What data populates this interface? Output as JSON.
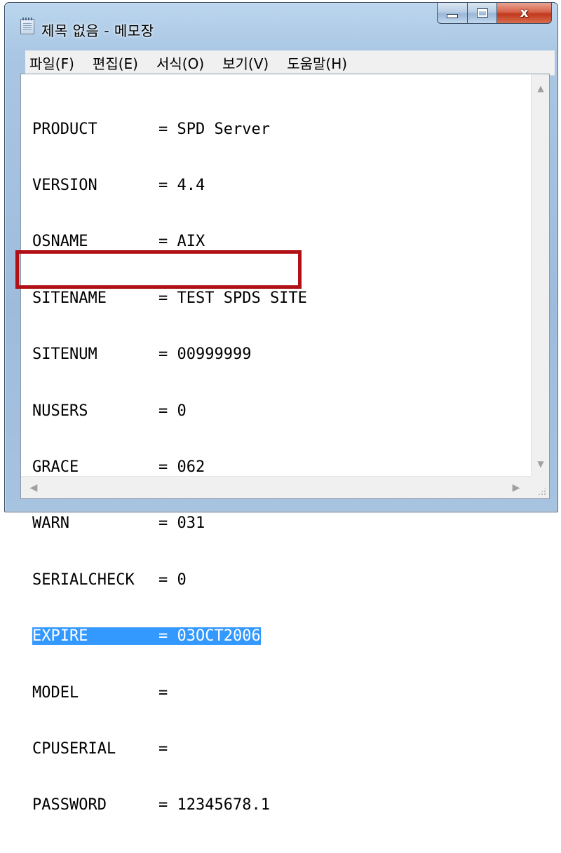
{
  "window": {
    "title": "제목 없음 - 메모장",
    "close_symbol": "x"
  },
  "menu": [
    {
      "label": "파일(F)"
    },
    {
      "label": "편집(E)"
    },
    {
      "label": "서식(O)"
    },
    {
      "label": "보기(V)"
    },
    {
      "label": "도움말(H)"
    }
  ],
  "document": {
    "lines": [
      {
        "key": "PRODUCT",
        "value": "= SPD Server"
      },
      {
        "key": "VERSION",
        "value": "= 4.4"
      },
      {
        "key": "OSNAME",
        "value": "= AIX"
      },
      {
        "key": "SITENAME",
        "value": "= TEST SPDS SITE"
      },
      {
        "key": "SITENUM",
        "value": "= 00999999"
      },
      {
        "key": "NUSERS",
        "value": "= 0"
      },
      {
        "key": "GRACE",
        "value": "= 062"
      },
      {
        "key": "WARN",
        "value": "= 031"
      },
      {
        "key": "SERIALCHECK",
        "value": "= 0"
      },
      {
        "key": "EXPIRE",
        "value": "= 03OCT2006"
      },
      {
        "key": "MODEL",
        "value": "="
      },
      {
        "key": "CPUSERIAL",
        "value": "="
      },
      {
        "key": "PASSWORD",
        "value": "= 12345678.1"
      }
    ],
    "selected_line_index": 9
  },
  "colors": {
    "selection": "#3399ff",
    "highlight_box": "#b01016",
    "close_button": "#c0391d"
  },
  "icons": {
    "app": "notepad-icon",
    "minimize": "minimize-icon",
    "maximize": "maximize-icon",
    "close": "close-icon",
    "scroll_up": "scroll-up-arrow-icon",
    "scroll_down": "scroll-down-arrow-icon",
    "scroll_left": "scroll-left-arrow-icon",
    "scroll_right": "scroll-right-arrow-icon",
    "resize_grip": "resize-grip-icon"
  }
}
